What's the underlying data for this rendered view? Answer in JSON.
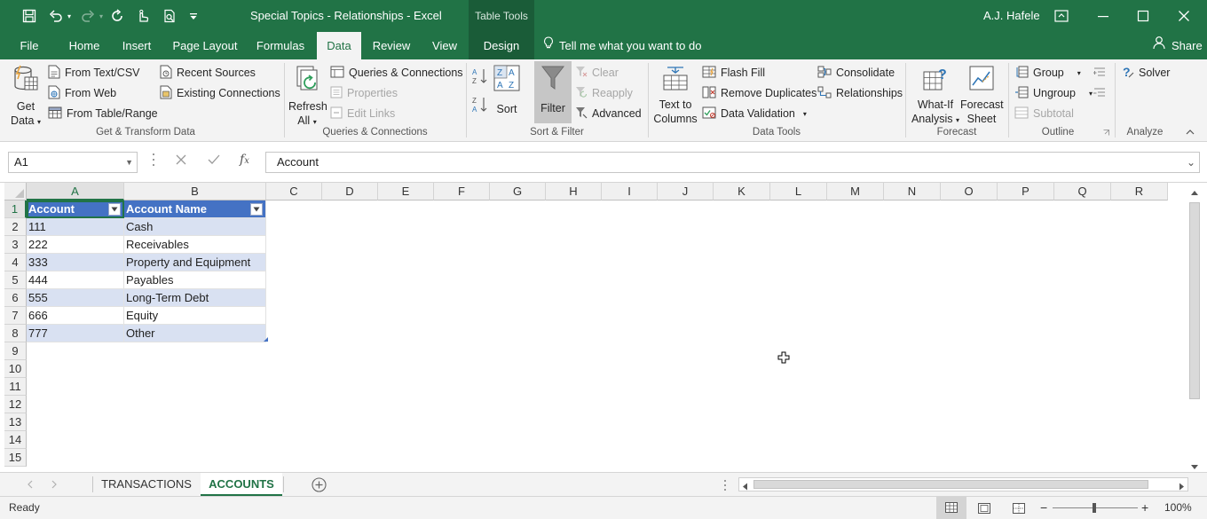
{
  "window": {
    "doc_title": "Special Topics - Relationships  -  Excel",
    "context_tab_group": "Table Tools",
    "user": "A.J. Hafele"
  },
  "tabs": [
    "File",
    "Home",
    "Insert",
    "Page Layout",
    "Formulas",
    "Data",
    "Review",
    "View",
    "Design"
  ],
  "active_tab": "Data",
  "tell_me": "Tell me what you want to do",
  "share": "Share",
  "ribbon": {
    "get_data": [
      "Get",
      "Data"
    ],
    "from_text_csv": "From Text/CSV",
    "from_web": "From Web",
    "from_table_range": "From Table/Range",
    "recent_sources": "Recent Sources",
    "existing_connections": "Existing Connections",
    "refresh_all": [
      "Refresh",
      "All"
    ],
    "queries_connections": "Queries & Connections",
    "properties": "Properties",
    "edit_links": "Edit Links",
    "sort": "Sort",
    "filter": "Filter",
    "clear": "Clear",
    "reapply": "Reapply",
    "advanced": "Advanced",
    "text_to_columns": [
      "Text to",
      "Columns"
    ],
    "flash_fill": "Flash Fill",
    "remove_duplicates": "Remove Duplicates",
    "data_validation": "Data Validation",
    "consolidate": "Consolidate",
    "relationships": "Relationships",
    "what_if": [
      "What-If",
      "Analysis"
    ],
    "forecast_sheet": [
      "Forecast",
      "Sheet"
    ],
    "group": "Group",
    "ungroup": "Ungroup",
    "subtotal": "Subtotal",
    "solver": "Solver",
    "groups": {
      "get_transform": "Get & Transform Data",
      "queries": "Queries & Connections",
      "sort_filter": "Sort & Filter",
      "data_tools": "Data Tools",
      "forecast": "Forecast",
      "outline": "Outline",
      "analyze": "Analyze"
    }
  },
  "formula_bar": {
    "name_box": "A1",
    "formula": "Account"
  },
  "grid": {
    "columns": [
      "A",
      "B",
      "C",
      "D",
      "E",
      "F",
      "G",
      "H",
      "I",
      "J",
      "K",
      "L",
      "M",
      "N",
      "O",
      "P",
      "Q",
      "R"
    ],
    "rows": [
      "1",
      "2",
      "3",
      "4",
      "5",
      "6",
      "7",
      "8",
      "9",
      "10",
      "11",
      "12",
      "13",
      "14",
      "15"
    ],
    "table": {
      "headers": [
        "Account",
        "Account Name"
      ],
      "rows": [
        [
          "111",
          "Cash"
        ],
        [
          "222",
          "Receivables"
        ],
        [
          "333",
          "Property and Equipment"
        ],
        [
          "444",
          "Payables"
        ],
        [
          "555",
          "Long-Term Debt"
        ],
        [
          "666",
          "Equity"
        ],
        [
          "777",
          "Other"
        ]
      ]
    }
  },
  "sheets": [
    "TRANSACTIONS",
    "ACCOUNTS"
  ],
  "active_sheet": "ACCOUNTS",
  "status": {
    "ready": "Ready",
    "zoom": "100%"
  },
  "colors": {
    "excel_green": "#217346",
    "table_header": "#4472c4",
    "table_band": "#d9e1f2"
  }
}
